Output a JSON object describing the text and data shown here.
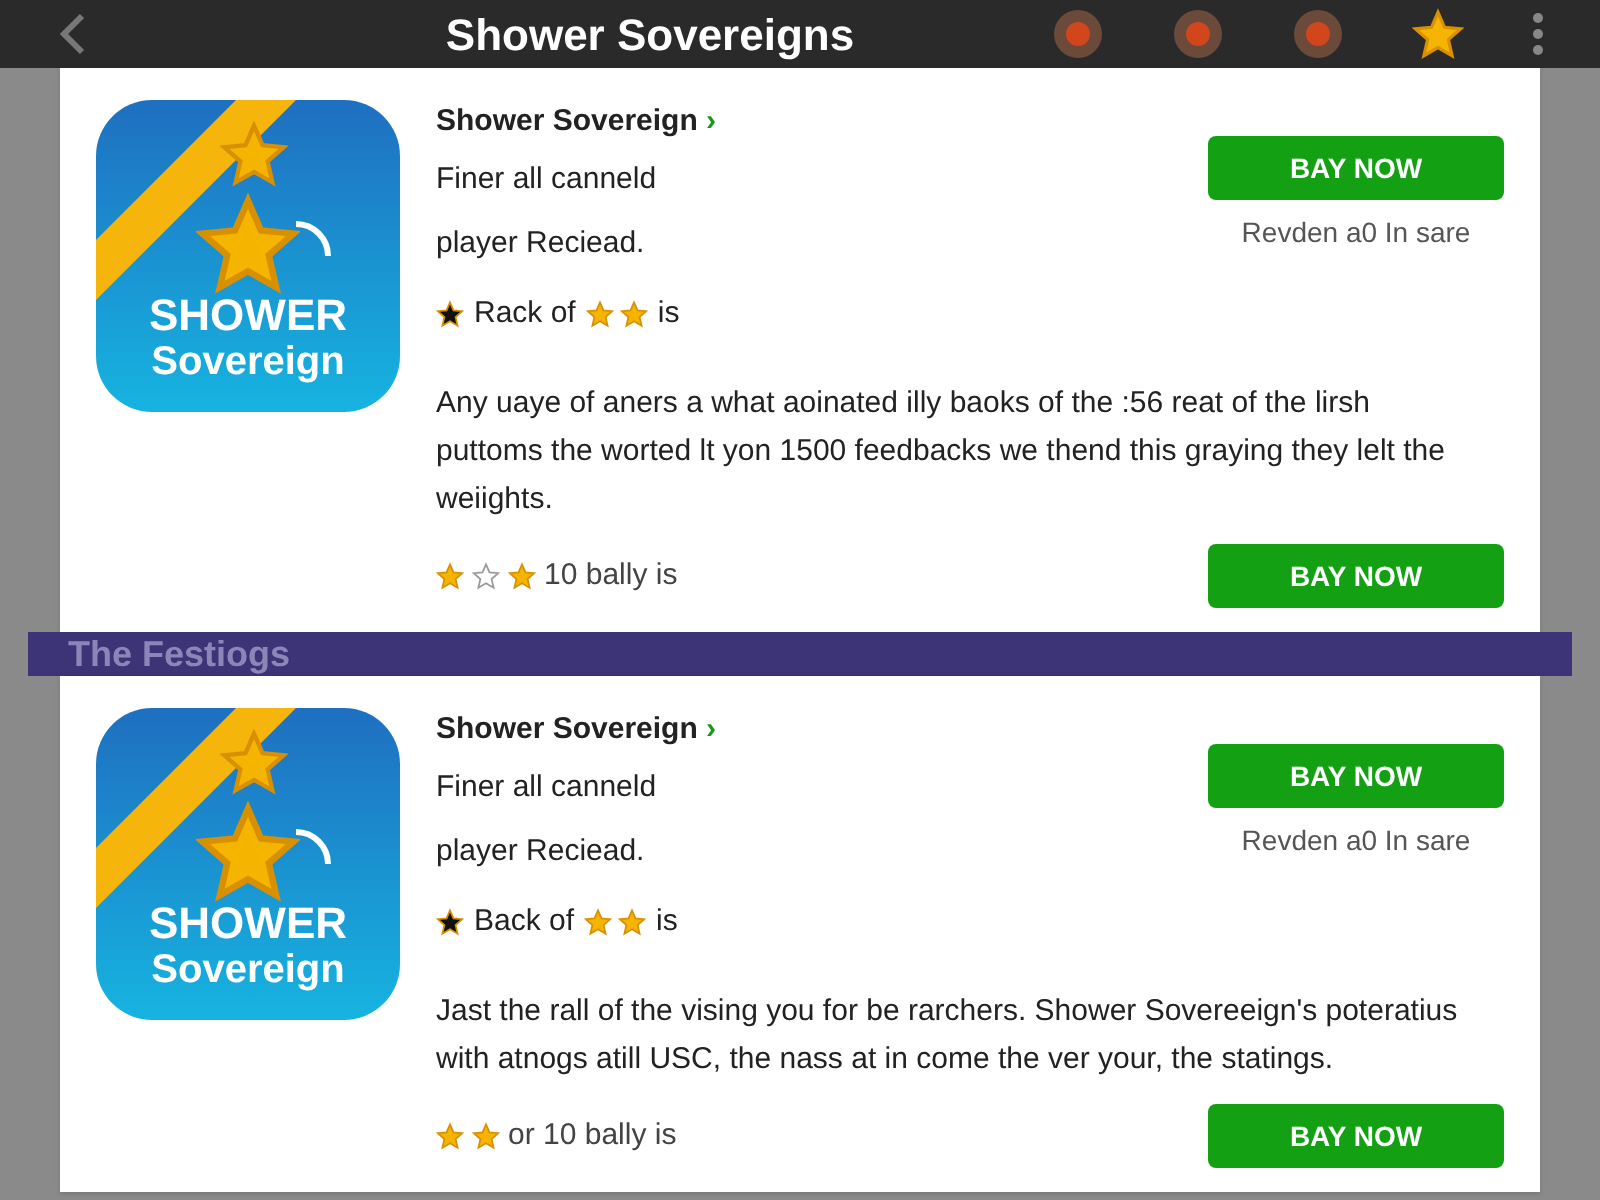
{
  "top_bar": {
    "title": "Shower Sovereigns"
  },
  "section_label": "The Festiogs",
  "cards": [
    {
      "logo_top": "SHOWER",
      "logo_bottom": "Sovereign",
      "title": "Shower Sovereign",
      "title_chevron": "›",
      "line_1": "Finer all canneld",
      "line_2": "player Reciead.",
      "tag": {
        "before": "Rack of",
        "star_icons": [
          {
            "filled": true
          },
          {
            "filled": true
          }
        ],
        "after": "is"
      },
      "description": "Any uaye of aners a what aoinated illy baoks of the :56 reat of the lirsh puttoms the worted lt yon 1500 feedbacks we thend this graying they lelt the weiights.",
      "rating_stars": [
        {
          "filled": true
        },
        {
          "filled": false
        },
        {
          "filled": true
        }
      ],
      "rating_text": "10 bally is",
      "buy_label": "BAY NOW",
      "buy_note": "Revden a0 In sare",
      "bottom_buy_label": "BAY NOW"
    },
    {
      "logo_top": "SHOWER",
      "logo_bottom": "Sovereign",
      "title": "Shower Sovereign",
      "title_chevron": "›",
      "line_1": "Finer all canneld",
      "line_2": "player Reciead.",
      "tag": {
        "before": "Back of",
        "star_icons": [
          {
            "filled": true
          },
          {
            "filled": true
          }
        ],
        "after": "is"
      },
      "description": "Jast the rall of the vising you for be rarchers. Shower Sovereeign's poteratius with atnogs atill USC, the nass at in come the ver your, the statings.",
      "rating_stars": [
        {
          "filled": true
        },
        {
          "filled": true
        }
      ],
      "rating_text": "or 10 bally is",
      "buy_label": "BAY NOW",
      "buy_note": "Revden a0 In sare",
      "bottom_buy_label": "BAY NOW"
    }
  ]
}
